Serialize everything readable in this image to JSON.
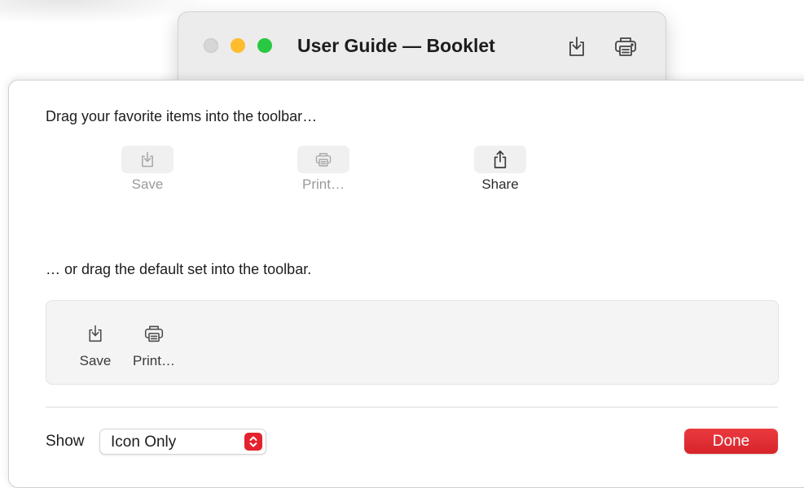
{
  "window": {
    "title": "User Guide — Booklet"
  },
  "sheet": {
    "favorites_heading": "Drag your favorite items into the toolbar…",
    "favorites": [
      {
        "label": "Save",
        "icon": "save-icon"
      },
      {
        "label": "Print…",
        "icon": "printer-icon"
      },
      {
        "label": "Share",
        "icon": "share-icon"
      }
    ],
    "default_heading": "… or drag the default set into the toolbar.",
    "default_set": [
      {
        "label": "Save",
        "icon": "save-icon"
      },
      {
        "label": "Print…",
        "icon": "printer-icon"
      }
    ],
    "show_label": "Show",
    "show_value": "Icon Only",
    "done_label": "Done"
  },
  "colors": {
    "accent": "#e3222d",
    "traffic_close": "#d6d6d6",
    "traffic_minimize": "#febc2e",
    "traffic_maximize": "#28c840"
  }
}
